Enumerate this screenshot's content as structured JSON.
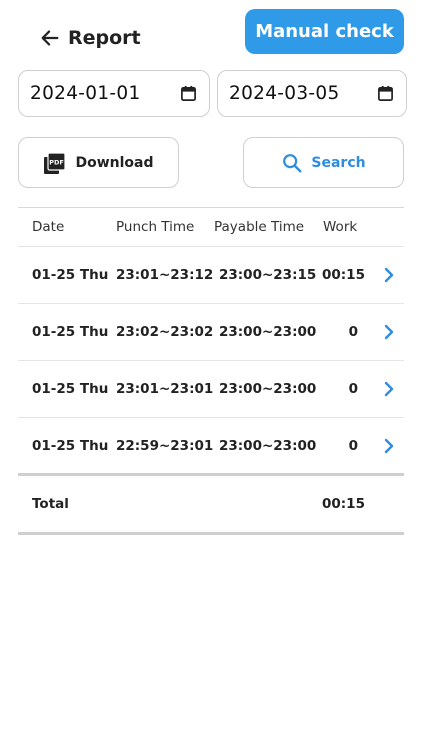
{
  "header": {
    "title": "Report",
    "manual_check_label": "Manual check"
  },
  "filters": {
    "start_date": "2024-01-01",
    "end_date": "2024-03-05",
    "download_label": "Download",
    "search_label": "Search"
  },
  "table": {
    "columns": [
      "Date",
      "Punch Time",
      "Payable Time",
      "Work"
    ],
    "rows": [
      {
        "date": "01-25 Thu",
        "punch": "23:01~23:12",
        "payable": "23:00~23:15",
        "work": "00:15"
      },
      {
        "date": "01-25 Thu",
        "punch": "23:02~23:02",
        "payable": "23:00~23:00",
        "work": "0"
      },
      {
        "date": "01-25 Thu",
        "punch": "23:01~23:01",
        "payable": "23:00~23:00",
        "work": "0"
      },
      {
        "date": "01-25 Thu",
        "punch": "22:59~23:01",
        "payable": "23:00~23:00",
        "work": "0"
      }
    ],
    "total_label": "Total",
    "total_value": "00:15"
  },
  "colors": {
    "accent": "#2f9ae8",
    "chevron": "#2f8de0"
  },
  "icons": {
    "back": "arrow-left-icon",
    "calendar": "calendar-icon",
    "pdf": "pdf-icon",
    "search": "search-icon",
    "row_open": "chevron-right-icon"
  }
}
